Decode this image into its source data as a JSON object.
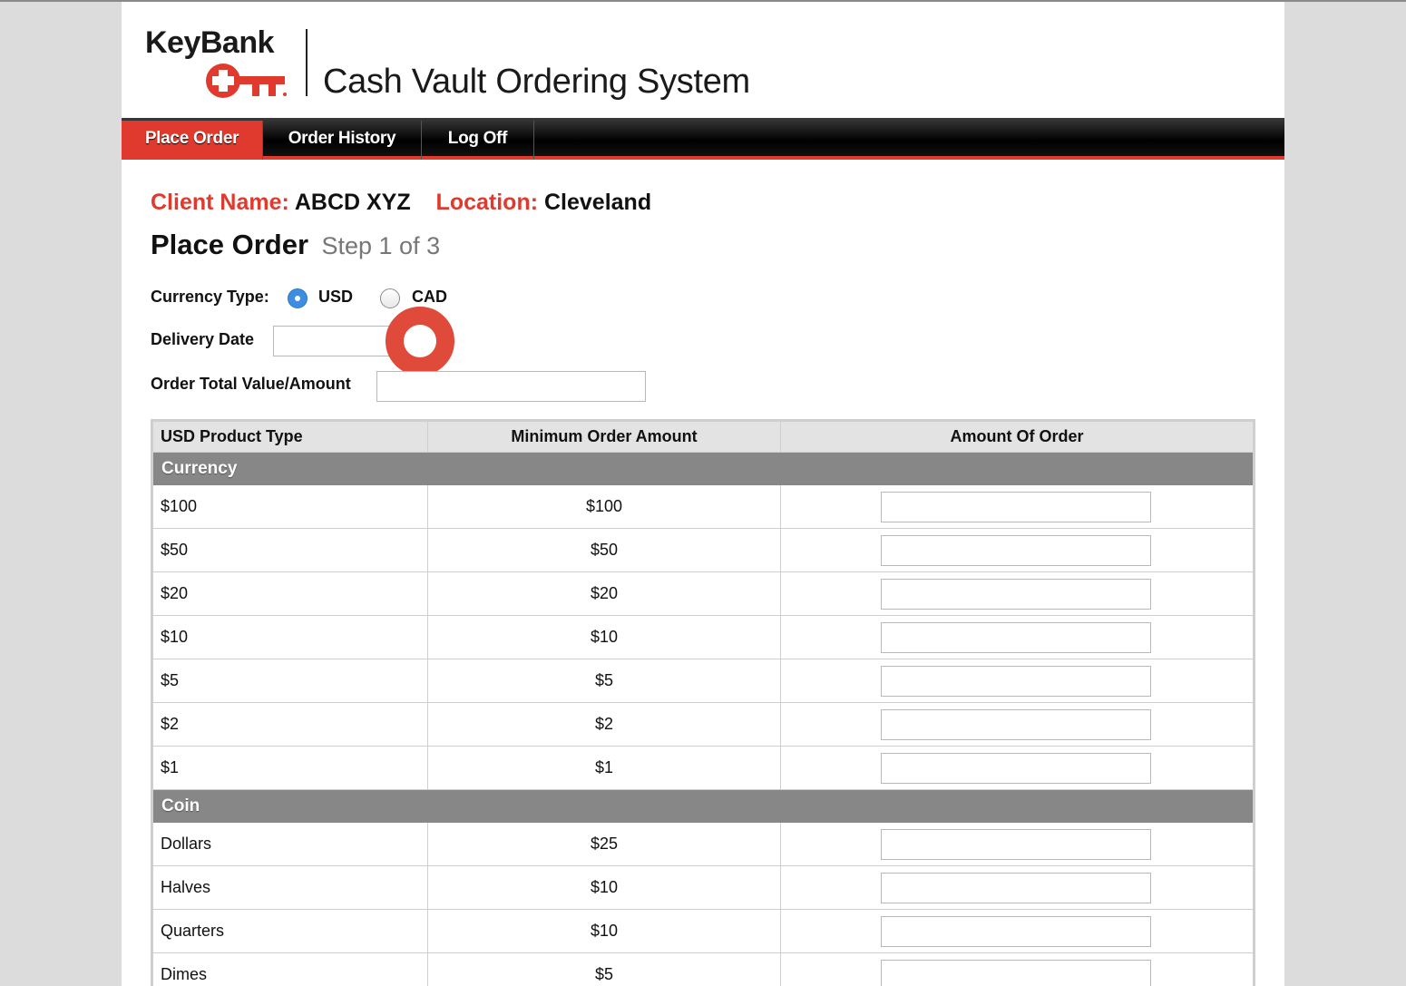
{
  "header": {
    "logo_text": "KeyBank",
    "app_title": "Cash Vault Ordering System"
  },
  "nav": {
    "items": [
      {
        "label": "Place Order",
        "active": true
      },
      {
        "label": "Order History",
        "active": false
      },
      {
        "label": "Log Off",
        "active": false
      }
    ]
  },
  "client": {
    "name_label": "Client Name:",
    "name_value": "ABCD XYZ",
    "location_label": "Location:",
    "location_value": "Cleveland"
  },
  "page": {
    "title": "Place Order",
    "step": "Step 1 of 3"
  },
  "form": {
    "currency_type_label": "Currency Type:",
    "currency_options": [
      {
        "label": "USD",
        "selected": true
      },
      {
        "label": "CAD",
        "selected": false
      }
    ],
    "delivery_date_label": "Delivery Date",
    "delivery_date_value": "",
    "order_total_label": "Order Total Value/Amount",
    "order_total_value": ""
  },
  "table": {
    "headers": [
      "USD Product Type",
      "Minimum Order Amount",
      "Amount Of Order"
    ],
    "sections": [
      {
        "name": "Currency",
        "rows": [
          {
            "product": "$100",
            "minimum": "$100",
            "amount": ""
          },
          {
            "product": "$50",
            "minimum": "$50",
            "amount": ""
          },
          {
            "product": "$20",
            "minimum": "$20",
            "amount": ""
          },
          {
            "product": "$10",
            "minimum": "$10",
            "amount": ""
          },
          {
            "product": "$5",
            "minimum": "$5",
            "amount": ""
          },
          {
            "product": "$2",
            "minimum": "$2",
            "amount": ""
          },
          {
            "product": "$1",
            "minimum": "$1",
            "amount": ""
          }
        ]
      },
      {
        "name": "Coin",
        "rows": [
          {
            "product": "Dollars",
            "minimum": "$25",
            "amount": ""
          },
          {
            "product": "Halves",
            "minimum": "$10",
            "amount": ""
          },
          {
            "product": "Quarters",
            "minimum": "$10",
            "amount": ""
          },
          {
            "product": "Dimes",
            "minimum": "$5",
            "amount": ""
          }
        ]
      }
    ]
  },
  "colors": {
    "brand_red": "#e03a2e",
    "nav_black": "#000000",
    "section_gray": "#878787",
    "radio_blue": "#3d8ee0"
  },
  "icons": {
    "logo": "keybank-key-icon",
    "cursor": "click-indicator-icon"
  }
}
